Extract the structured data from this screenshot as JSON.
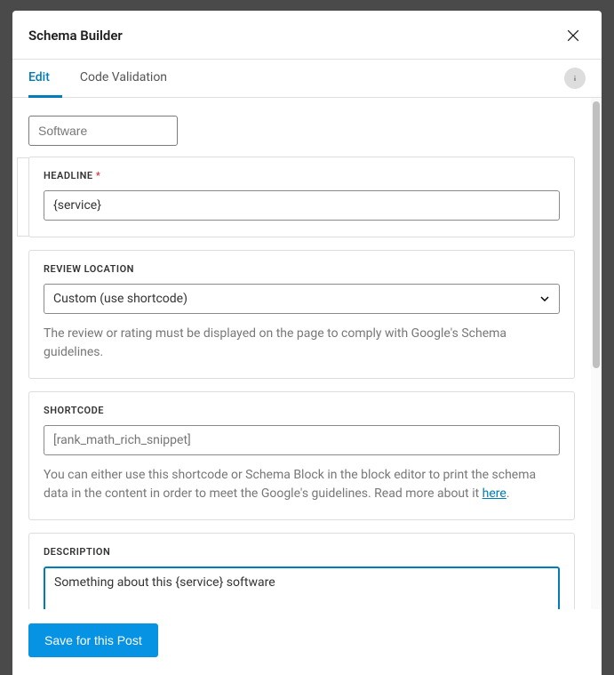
{
  "modal": {
    "title": "Schema Builder"
  },
  "tabs": {
    "edit": "Edit",
    "code_validation": "Code Validation"
  },
  "form": {
    "schema_type": "Software",
    "headline": {
      "label": "HEADLINE",
      "required": "*",
      "value": "{service}"
    },
    "review_location": {
      "label": "REVIEW LOCATION",
      "value": "Custom (use shortcode)",
      "help": "The review or rating must be displayed on the page to comply with Google's Schema guidelines."
    },
    "shortcode": {
      "label": "SHORTCODE",
      "placeholder": "[rank_math_rich_snippet]",
      "help_pre": "You can either use this shortcode or Schema Block in the block editor to print the schema data in the content in order to meet the Google's guidelines. Read more about it ",
      "help_link": "here",
      "help_post": "."
    },
    "description": {
      "label": "DESCRIPTION",
      "value": "Something about this {service} software"
    }
  },
  "footer": {
    "save": "Save for this Post"
  }
}
